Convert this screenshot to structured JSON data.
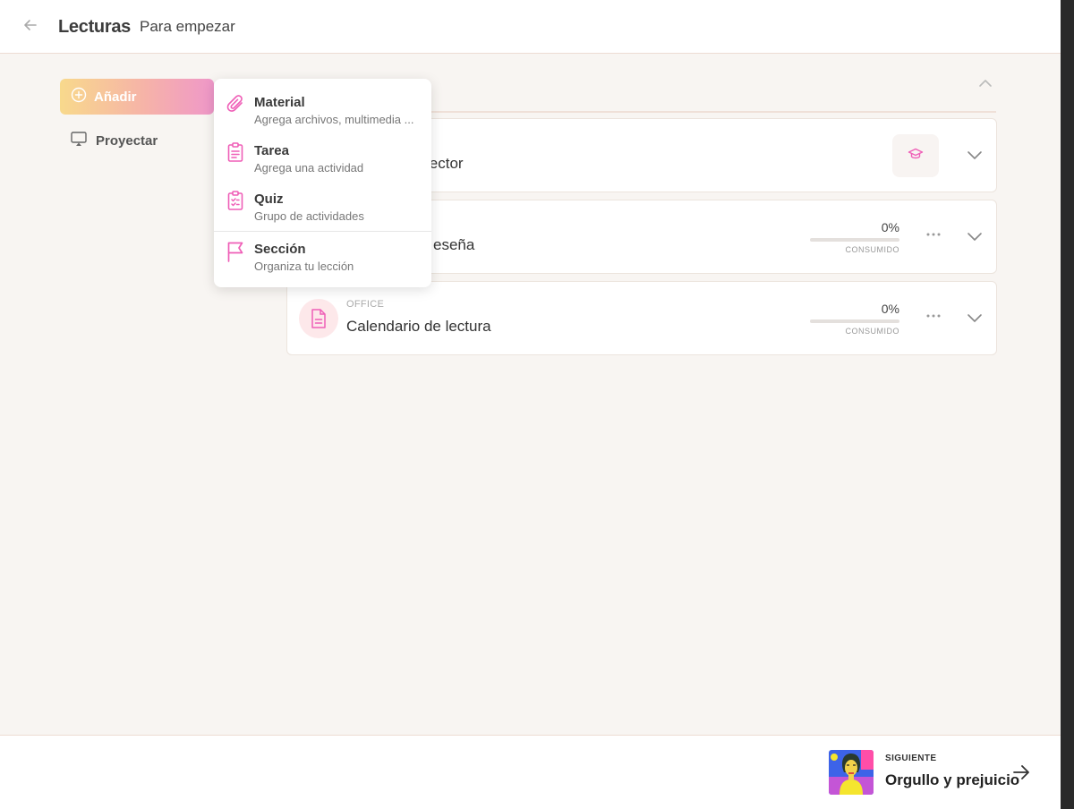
{
  "header": {
    "title": "Lecturas",
    "subtitle": "Para empezar"
  },
  "sidebar": {
    "add_label": "Añadir",
    "project_label": "Proyectar"
  },
  "menu": {
    "items": [
      {
        "title": "Material",
        "subtitle": "Agrega archivos, multimedia ...",
        "icon": "paperclip-icon"
      },
      {
        "title": "Tarea",
        "subtitle": "Agrega una actividad",
        "icon": "clipboard-list-icon"
      },
      {
        "title": "Quiz",
        "subtitle": "Grupo de actividades",
        "icon": "clipboard-check-icon"
      },
      {
        "title": "Sección",
        "subtitle": "Organiza tu lección",
        "icon": "flag-icon"
      }
    ]
  },
  "cards": [
    {
      "title_visible": "lector",
      "icon": "graduation-cap-icon"
    },
    {
      "title_visible": "eseña",
      "progress": "0%",
      "progress_value": 0,
      "consumed_label": "CONSUMIDO"
    },
    {
      "type": "OFFICE",
      "title": "Calendario de lectura",
      "progress": "0%",
      "progress_value": 0,
      "consumed_label": "CONSUMIDO",
      "icon": "document-icon"
    }
  ],
  "footer": {
    "next_label": "SIGUIENTE",
    "next_title": "Orgullo y prejuicio"
  },
  "colors": {
    "accent": "#ef5fb7",
    "gradient_start": "#f8d98c",
    "gradient_end": "#ef97c9",
    "page_bg": "#f8f5f2"
  }
}
